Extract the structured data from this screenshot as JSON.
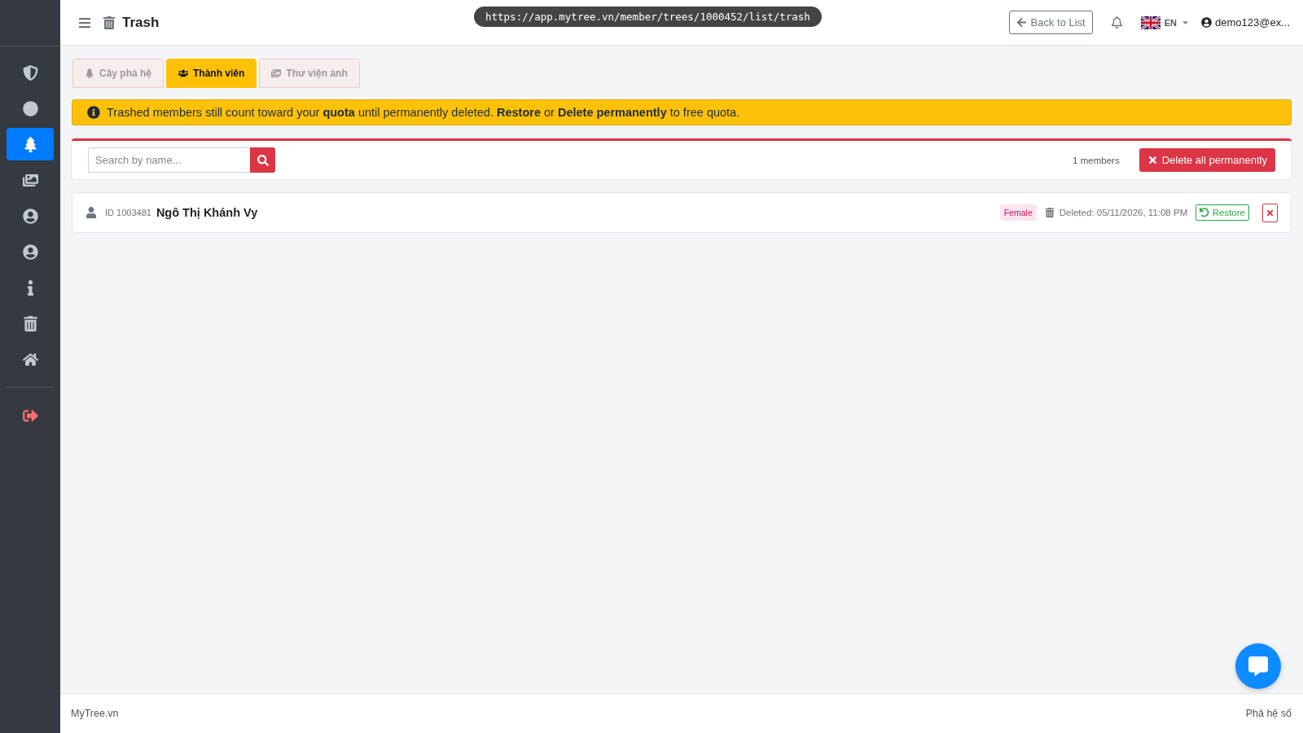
{
  "sidebar": {
    "items": [
      {
        "kind": "nav",
        "selected": false
      },
      {
        "kind": "nav",
        "selected": false
      },
      {
        "kind": "nav",
        "selected": true
      },
      {
        "kind": "nav",
        "selected": false
      },
      {
        "kind": "nav",
        "selected": false
      },
      {
        "kind": "nav",
        "selected": false
      },
      {
        "kind": "nav",
        "selected": false
      },
      {
        "kind": "nav",
        "selected": false
      },
      {
        "kind": "nav",
        "selected": false
      },
      {
        "kind": "logout",
        "selected": false
      }
    ]
  },
  "header": {
    "title": "Trash",
    "url": "https://app.mytree.vn/member/trees/1000452/list/trash",
    "back_button": "Back to List",
    "language": "EN",
    "user": "demo123@ex..."
  },
  "tabs": [
    {
      "label": "Cây phả hệ",
      "selected": false
    },
    {
      "label": "Thành viên",
      "selected": true
    },
    {
      "label": "Thư viện ảnh",
      "selected": false
    }
  ],
  "alert": "Trashed members still count toward your **quota** until permanently deleted. **Restore** or **Delete permanently** to free quota.",
  "toolbar": {
    "search_placeholder": "Search by name...",
    "count": "1 members",
    "delete_all": "Delete all permanently"
  },
  "members": [
    {
      "id": "ID 1003481",
      "name": "Ngô Thị Khánh Vy",
      "gender": "Female",
      "deleted": "Deleted: 05/11/2026, 11:08 PM",
      "restore": "Restore"
    }
  ],
  "footer": {
    "left": "MyTree.vn",
    "right": "Phả hệ số"
  }
}
